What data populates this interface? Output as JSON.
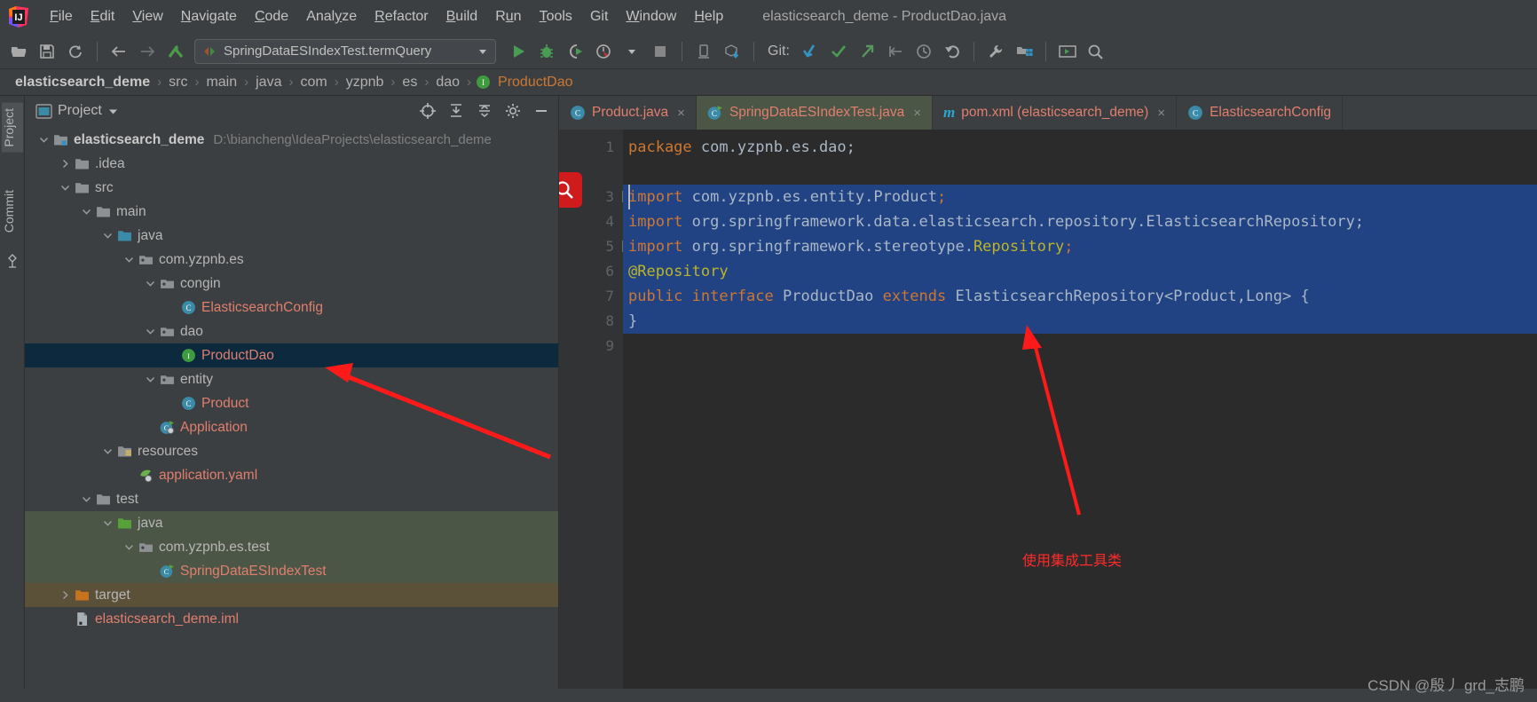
{
  "window": {
    "title": "elasticsearch_deme - ProductDao.java"
  },
  "menubar": {
    "logo": "intellij-idea-logo",
    "items": [
      {
        "label": "File",
        "mnemonic": "F"
      },
      {
        "label": "Edit",
        "mnemonic": "E"
      },
      {
        "label": "View",
        "mnemonic": "V"
      },
      {
        "label": "Navigate",
        "mnemonic": "N"
      },
      {
        "label": "Code",
        "mnemonic": "C"
      },
      {
        "label": "Analyze",
        "mnemonic": "y"
      },
      {
        "label": "Refactor",
        "mnemonic": "R"
      },
      {
        "label": "Build",
        "mnemonic": "B"
      },
      {
        "label": "Run",
        "mnemonic": "u"
      },
      {
        "label": "Tools",
        "mnemonic": "T"
      },
      {
        "label": "Git",
        "mnemonic": ""
      },
      {
        "label": "Window",
        "mnemonic": "W"
      },
      {
        "label": "Help",
        "mnemonic": "H"
      }
    ]
  },
  "toolbar": {
    "open_label": "open-folder-icon",
    "save_label": "save-icon",
    "sync_label": "sync-icon",
    "back_label": "back-arrow-icon",
    "forward_label": "forward-arrow-icon",
    "jump_label": "jump-to-source-icon",
    "run_config": {
      "value": "SpringDataESIndexTest.termQuery",
      "dropdown": "chevron-down-icon"
    },
    "run_label": "run-icon",
    "debug_label": "debug-icon",
    "coverage_label": "run-with-coverage-icon",
    "profile_label": "profile-icon",
    "stop_label": "stop-icon",
    "device_label": "device-manager-icon",
    "sdk_label": "sdk-download-icon",
    "git_label": "Git:",
    "git_update_label": "update-project-icon",
    "git_commit_label": "commit-icon",
    "git_push_label": "push-icon",
    "git_pullreq_label": "rollback-branch-icon",
    "git_history_label": "history-icon",
    "git_revert_label": "revert-icon",
    "settings_label": "wrench-settings-icon",
    "structure_label": "project-structure-icon",
    "terminal_label": "terminal-icon",
    "search_label": "search-everywhere-icon"
  },
  "breadcrumb": {
    "items": [
      {
        "label": "elasticsearch_deme",
        "style": "first"
      },
      {
        "label": "src",
        "style": "plain"
      },
      {
        "label": "main",
        "style": "plain"
      },
      {
        "label": "java",
        "style": "plain"
      },
      {
        "label": "com",
        "style": "plain"
      },
      {
        "label": "yzpnb",
        "style": "plain"
      },
      {
        "label": "es",
        "style": "plain"
      },
      {
        "label": "dao",
        "style": "plain"
      },
      {
        "label": "ProductDao",
        "style": "leaf",
        "icon": "interface-icon"
      }
    ],
    "separator": "›"
  },
  "stripe": {
    "project_label": "Project",
    "commit_label": "Commit",
    "structure_icon": "structure-icon"
  },
  "project_panel": {
    "title": "Project",
    "dropdown_icon": "chevron-down-icon",
    "window_icon": "project-window-icon",
    "actions": [
      {
        "name": "select-opened-file-icon"
      },
      {
        "name": "expand-all-icon"
      },
      {
        "name": "collapse-all-icon"
      },
      {
        "name": "settings-gear-icon"
      },
      {
        "name": "hide-icon"
      }
    ],
    "tree": [
      {
        "indent": 0,
        "arrow": "down",
        "icon": "module-folder-icon",
        "label": "elasticsearch_deme",
        "style": "bold",
        "sub": "D:\\biancheng\\IdeaProjects\\elasticsearch_deme",
        "scope": "none"
      },
      {
        "indent": 1,
        "arrow": "right",
        "icon": "folder-icon",
        "label": ".idea",
        "style": "plain",
        "sub": "",
        "scope": "none"
      },
      {
        "indent": 1,
        "arrow": "down",
        "icon": "folder-icon",
        "label": "src",
        "style": "plain",
        "sub": "",
        "scope": "none"
      },
      {
        "indent": 2,
        "arrow": "down",
        "icon": "folder-icon",
        "label": "main",
        "style": "plain",
        "sub": "",
        "scope": "none"
      },
      {
        "indent": 3,
        "arrow": "down",
        "icon": "source-folder-icon",
        "label": "java",
        "style": "plain",
        "sub": "",
        "scope": "none"
      },
      {
        "indent": 4,
        "arrow": "down",
        "icon": "package-icon",
        "label": "com.yzpnb.es",
        "style": "plain",
        "sub": "",
        "scope": "none"
      },
      {
        "indent": 5,
        "arrow": "down",
        "icon": "package-icon",
        "label": "congin",
        "style": "plain",
        "sub": "",
        "scope": "none"
      },
      {
        "indent": 6,
        "arrow": "none",
        "icon": "class-icon",
        "label": "ElasticsearchConfig",
        "style": "red",
        "sub": "",
        "scope": "none"
      },
      {
        "indent": 5,
        "arrow": "down",
        "icon": "package-icon",
        "label": "dao",
        "style": "plain",
        "sub": "",
        "scope": "none"
      },
      {
        "indent": 6,
        "arrow": "none",
        "icon": "interface-icon",
        "label": "ProductDao",
        "style": "red",
        "sub": "",
        "scope": "selected"
      },
      {
        "indent": 5,
        "arrow": "down",
        "icon": "package-icon",
        "label": "entity",
        "style": "plain",
        "sub": "",
        "scope": "none"
      },
      {
        "indent": 6,
        "arrow": "none",
        "icon": "class-icon",
        "label": "Product",
        "style": "red",
        "sub": "",
        "scope": "none"
      },
      {
        "indent": 5,
        "arrow": "none",
        "icon": "runnable-class-icon",
        "label": "Application",
        "style": "red",
        "sub": "",
        "scope": "none"
      },
      {
        "indent": 3,
        "arrow": "down",
        "icon": "resources-folder-icon",
        "label": "resources",
        "style": "plain",
        "sub": "",
        "scope": "none"
      },
      {
        "indent": 4,
        "arrow": "none",
        "icon": "yaml-icon",
        "label": "application.yaml",
        "style": "red",
        "sub": "",
        "scope": "none"
      },
      {
        "indent": 2,
        "arrow": "down",
        "icon": "folder-icon",
        "label": "test",
        "style": "plain",
        "sub": "",
        "scope": "none"
      },
      {
        "indent": 3,
        "arrow": "down",
        "icon": "test-source-folder-icon",
        "label": "java",
        "style": "plain",
        "sub": "",
        "scope": "test"
      },
      {
        "indent": 4,
        "arrow": "down",
        "icon": "package-icon",
        "label": "com.yzpnb.es.test",
        "style": "plain",
        "sub": "",
        "scope": "test"
      },
      {
        "indent": 5,
        "arrow": "none",
        "icon": "test-class-icon",
        "label": "SpringDataESIndexTest",
        "style": "red",
        "sub": "",
        "scope": "test"
      },
      {
        "indent": 1,
        "arrow": "right",
        "icon": "excluded-folder-icon",
        "label": "target",
        "style": "plain",
        "sub": "",
        "scope": "target"
      },
      {
        "indent": 1,
        "arrow": "none",
        "icon": "iml-file-icon",
        "label": "elasticsearch_deme.iml",
        "style": "red",
        "sub": "",
        "scope": "none"
      }
    ]
  },
  "editor": {
    "tabs": [
      {
        "label": "Product.java",
        "icon": "class-icon",
        "active": false,
        "scope": "none",
        "close": "×"
      },
      {
        "label": "SpringDataESIndexTest.java",
        "icon": "test-class-icon",
        "active": false,
        "scope": "test",
        "close": "×"
      },
      {
        "label": "pom.xml (elasticsearch_deme)",
        "icon": "maven-icon",
        "active": false,
        "scope": "none",
        "close": "×"
      },
      {
        "label": "ElasticsearchConfig",
        "icon": "class-icon",
        "active": false,
        "scope": "none",
        "close": ""
      }
    ],
    "search_badge_icon": "search-icon",
    "line_numbers": [
      "1",
      "",
      "3",
      "4",
      "5",
      "6",
      "7",
      "8",
      "9"
    ],
    "gutter_marks": [
      {
        "line": 3,
        "mark": "fold-collapse"
      },
      {
        "line": 5,
        "mark": "fold-end"
      },
      {
        "line": 7,
        "mark": "spring-bean-icon"
      }
    ],
    "lines": [
      {
        "n": "1",
        "selected": false,
        "tokens": [
          {
            "t": "package",
            "c": "kw"
          },
          {
            "t": " com.yzpnb.es.dao;",
            "c": "pl"
          }
        ]
      },
      {
        "n": "",
        "selected": false,
        "tokens": []
      },
      {
        "n": "3",
        "selected": true,
        "tokens": [
          {
            "t": "import",
            "c": "kw"
          },
          {
            "t": " com.yzpnb.es.entity.Product",
            "c": "pl"
          },
          {
            "t": ";",
            "c": "kw"
          }
        ]
      },
      {
        "n": "4",
        "selected": true,
        "tokens": [
          {
            "t": "import",
            "c": "kw"
          },
          {
            "t": " org.springframework.data.elasticsearch.repository.ElasticsearchRepository;",
            "c": "pl"
          }
        ]
      },
      {
        "n": "5",
        "selected": true,
        "tokens": [
          {
            "t": "import",
            "c": "kw"
          },
          {
            "t": " org.springframework.stereotype.",
            "c": "pl"
          },
          {
            "t": "Repository",
            "c": "ann"
          },
          {
            "t": ";",
            "c": "kw"
          }
        ]
      },
      {
        "n": "6",
        "selected": true,
        "tokens": [
          {
            "t": "@Repository",
            "c": "ann"
          }
        ]
      },
      {
        "n": "7",
        "selected": true,
        "tokens": [
          {
            "t": "public interface",
            "c": "kw"
          },
          {
            "t": " ProductDao ",
            "c": "pl"
          },
          {
            "t": "extends",
            "c": "kw"
          },
          {
            "t": " ElasticsearchRepository<Product,Long> {",
            "c": "pl"
          }
        ]
      },
      {
        "n": "8",
        "selected": true,
        "tokens": [
          {
            "t": "}",
            "c": "pl"
          }
        ]
      },
      {
        "n": "9",
        "selected": false,
        "tokens": []
      }
    ]
  },
  "annotations": {
    "note_text": "使用集成工具类",
    "arrow_color": "#ff1a1a",
    "watermark": "CSDN @殷丿 grd_志鹏"
  },
  "colors": {
    "accent_blue": "#214283",
    "selection_tree": "#0d293e",
    "test_scope": "#4c5646",
    "target_scope": "#5b5038",
    "keyword": "#cc7832",
    "annotation": "#bbb529",
    "plain": "#a9b7c6",
    "panel_bg": "#3c3f41",
    "editor_bg": "#2b2b2b",
    "red_file": "#e07f6e"
  }
}
